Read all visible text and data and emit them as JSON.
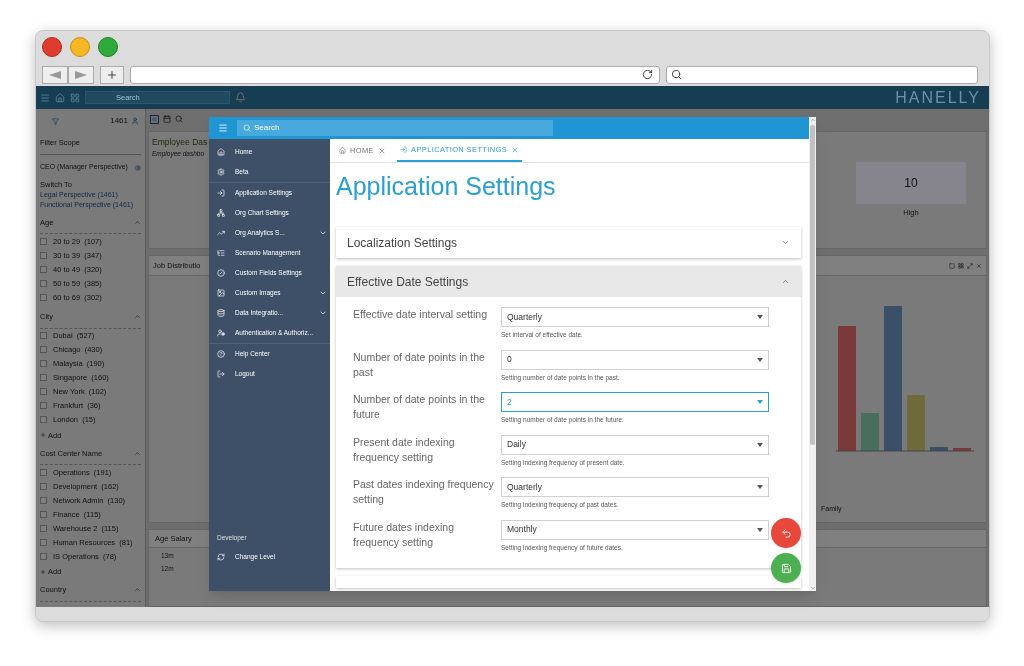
{
  "app": {
    "brand": "HANELLY",
    "search_placeholder": "Search"
  },
  "filter_panel": {
    "count": "1461",
    "scope_label": "Filter Scope",
    "perspective": "CEO (Manager Perspective)",
    "switch_label": "Switch To",
    "links": [
      "Legal Perspective (1461)",
      "Functional Perspective (1461)"
    ],
    "groups": [
      {
        "title": "Age",
        "expanded": true,
        "items": [
          {
            "label": "20 to 29  (107)",
            "checked": false
          },
          {
            "label": "30 to 39  (347)",
            "checked": false
          },
          {
            "label": "40 to 49  (320)",
            "checked": false
          },
          {
            "label": "50 to 59  (385)",
            "checked": false
          },
          {
            "label": "60 to 69  (302)",
            "checked": false
          }
        ]
      },
      {
        "title": "City",
        "expanded": true,
        "add_label": "Add",
        "items": [
          {
            "label": "Dubai  (527)",
            "checked": false
          },
          {
            "label": "Chicago  (430)",
            "checked": false
          },
          {
            "label": "Malaysia  (190)",
            "checked": false
          },
          {
            "label": "Singapore  (160)",
            "checked": false
          },
          {
            "label": "New York  (102)",
            "checked": false
          },
          {
            "label": "Frankfurt  (36)",
            "checked": false
          },
          {
            "label": "London  (15)",
            "checked": false
          }
        ]
      },
      {
        "title": "Cost Center Name",
        "expanded": true,
        "add_label": "Add",
        "items": [
          {
            "label": "Operations  (191)",
            "checked": false
          },
          {
            "label": "Development  (162)",
            "checked": false
          },
          {
            "label": "Network Admin  (130)",
            "checked": false
          },
          {
            "label": "Finance  (115)",
            "checked": false
          },
          {
            "label": "Warehouse 2  (115)",
            "checked": false
          },
          {
            "label": "Human Resources  (81)",
            "checked": false
          },
          {
            "label": "IS Operations  (78)",
            "checked": false
          }
        ]
      },
      {
        "title": "Country",
        "expanded": true
      }
    ]
  },
  "dashboard": {
    "title": "Employee Das",
    "subtitle": "Employee dashbo",
    "tile_value": "10",
    "tile_label": "High"
  },
  "job_card": {
    "title": "Job Distributio",
    "axis_label": "Family"
  },
  "salary_card": {
    "title": "Age Salary",
    "ticks": [
      "13m",
      "12m"
    ]
  },
  "modal": {
    "search_placeholder": "Search",
    "nav_sections": [
      [
        {
          "label": "Home",
          "has_submenu": false
        },
        {
          "label": "Beta",
          "has_submenu": false
        }
      ],
      [
        {
          "label": "Application Settings",
          "has_submenu": false
        },
        {
          "label": "Org Chart Settings",
          "has_submenu": false
        },
        {
          "label": "Org Analytics S...",
          "has_submenu": true
        },
        {
          "label": "Scenario Management",
          "has_submenu": false
        },
        {
          "label": "Custom Fields Settings",
          "has_submenu": false
        },
        {
          "label": "Custom Images",
          "has_submenu": true
        },
        {
          "label": "Data Integratio...",
          "has_submenu": true
        },
        {
          "label": "Authentication & Authoriz...",
          "has_submenu": false
        }
      ],
      [
        {
          "label": "Help Center",
          "has_submenu": false
        },
        {
          "label": "Logout",
          "has_submenu": false
        }
      ]
    ],
    "developer": {
      "heading": "Developer",
      "item": "Change Level"
    },
    "tabs": [
      {
        "label": "HOME",
        "selected": false
      },
      {
        "label": "APPLICATION SETTINGS",
        "selected": true
      }
    ],
    "title": "Application Settings",
    "sections": [
      {
        "title": "Localization Settings",
        "expanded": false
      },
      {
        "title": "Effective Date Settings",
        "expanded": true,
        "fields": [
          {
            "label": "Effective date interval setting",
            "value": "Quarterly",
            "help": "Set interval of effective date.",
            "focused": false
          },
          {
            "label": "Number of date points in the past",
            "value": "0",
            "help": "Setting number of date points in the past.",
            "focused": false
          },
          {
            "label": "Number of date points in the future",
            "value": "2",
            "help": "Setting number of date points in the future.",
            "focused": true
          },
          {
            "label": "Present date indexing frequency setting",
            "value": "Daily",
            "help": "Setting indexing frequency of present date.",
            "focused": false
          },
          {
            "label": "Past dates indexing frequency setting",
            "value": "Quarterly",
            "help": "Setting indexing frequency of past dates.",
            "focused": false
          },
          {
            "label": "Future dates indexing frequency setting",
            "value": "Monthly",
            "help": "Setting indexing frequency of future dates.",
            "focused": false
          }
        ]
      }
    ]
  }
}
